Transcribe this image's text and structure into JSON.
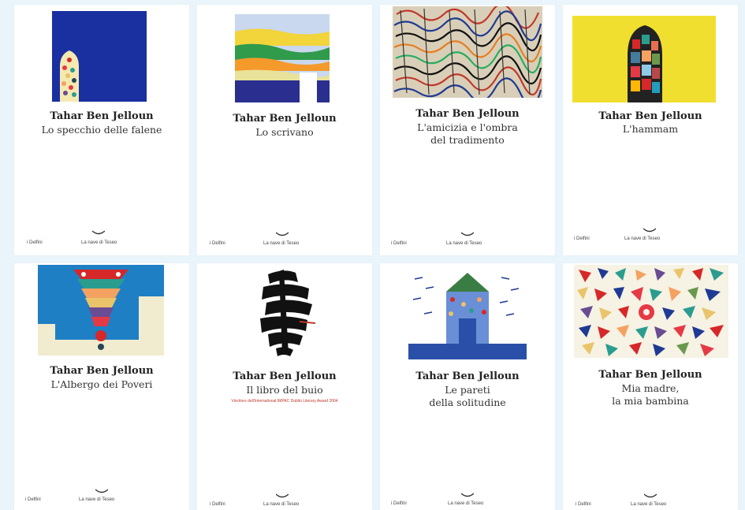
{
  "books": [
    {
      "author": "Tahar Ben Jelloun",
      "title": "Lo specchio delle falene",
      "series": "i Delfini",
      "publisher": "La nave di Teseo",
      "art_icon": "stained-glass-window-art"
    },
    {
      "author": "Tahar Ben Jelloun",
      "title": "Lo scrivano",
      "series": "i Delfini",
      "publisher": "La nave di Teseo",
      "art_icon": "striped-landscape-art"
    },
    {
      "author": "Tahar Ben Jelloun",
      "title": "L'amicizia e l'ombra\ndel tradimento",
      "series": "i Delfini",
      "publisher": "La nave di Teseo",
      "art_icon": "abstract-scribble-art"
    },
    {
      "author": "Tahar Ben Jelloun",
      "title": "L'hammam",
      "series": "i Delfini",
      "publisher": "La nave di Teseo",
      "art_icon": "patchwork-figure-art"
    },
    {
      "author": "Tahar Ben Jelloun",
      "title": "L'Albergo dei Poveri",
      "series": "i Delfini",
      "publisher": "La nave di Teseo",
      "art_icon": "colorful-pagoda-art"
    },
    {
      "author": "Tahar Ben Jelloun",
      "title": "Il libro del buio",
      "award": "Vincitore dell'International IMPAC Dublin Literary Award 2004",
      "series": "i Delfini",
      "publisher": "La nave di Teseo",
      "art_icon": "black-brushstroke-art"
    },
    {
      "author": "Tahar Ben Jelloun",
      "title": "Le pareti\ndella solitudine",
      "series": "i Delfini",
      "publisher": "La nave di Teseo",
      "art_icon": "blue-tower-art"
    },
    {
      "author": "Tahar Ben Jelloun",
      "title": "Mia madre,\nla mia bambina",
      "series": "i Delfini",
      "publisher": "La nave di Teseo",
      "art_icon": "mosaic-shapes-art"
    }
  ],
  "colors": {
    "background": "#eaf5fb",
    "award_red": "#c0392b"
  }
}
